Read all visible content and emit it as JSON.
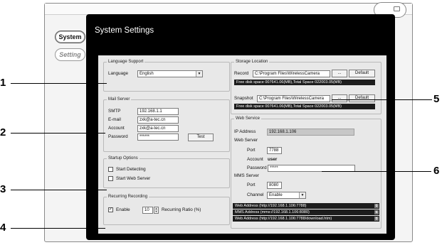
{
  "sidebar": {
    "system_label": "System",
    "setting_label": "Setting"
  },
  "panel": {
    "title": "System Settings"
  },
  "language": {
    "group": "Language Support",
    "label": "Language",
    "value": "English"
  },
  "mail": {
    "group": "Mail Server",
    "smtp_label": "SMTP",
    "smtp_value": "192.168.1.1",
    "email_label": "E-mail",
    "email_value": "zxk@a-tec.cn",
    "account_label": "Account",
    "account_value": "zxk@a-tec.cn",
    "password_label": "Password",
    "password_value": "******",
    "test_button": "Test"
  },
  "startup": {
    "group": "Startup Options",
    "start_detecting": "Start Detecting",
    "start_web_server": "Start Web Server"
  },
  "recurring": {
    "group": "Recurring Recording",
    "enable_label": "Enable",
    "value": "10",
    "ratio_label": "Recurring Ratio (%)"
  },
  "storage": {
    "group": "Storage Location",
    "record_label": "Record",
    "record_path": "C:\\Program Files\\WirelessCamera",
    "browse_label": "...",
    "default_label": "Default",
    "record_free": "Free disk space 007641.06(MB),Total Space 022003.05(MB)",
    "snapshot_label": "Snapshot",
    "snapshot_path": "C:\\Program Files\\WirelessCamera",
    "snapshot_free": "Free disk space 007641.06(MB),Total Space 022003.05(MB)"
  },
  "web": {
    "group": "Web Service",
    "ip_label": "IP Address",
    "ip_value": "192.168.1.106",
    "web_server_label": "Web Server",
    "port_label": "Port",
    "port_value": "7788",
    "account_label": "Account",
    "account_value": "user",
    "password_label": "Password",
    "password_value": "*****",
    "mms_label": "MMS Server",
    "mms_port_label": "Port",
    "mms_port_value": "8080",
    "channel_label": "Channel",
    "channel_value": "Enable",
    "address_1": "Web Address  (http://192.168.1.106:7788)",
    "address_2": "MMS Address  (mms://192.168.1.106:8080)",
    "address_3": "Web Address  (http://192.168.1.106:7788/download.htm)"
  },
  "callouts": {
    "n1": "1",
    "n2": "2",
    "n3": "3",
    "n4": "4",
    "n5": "5",
    "n6": "6"
  }
}
